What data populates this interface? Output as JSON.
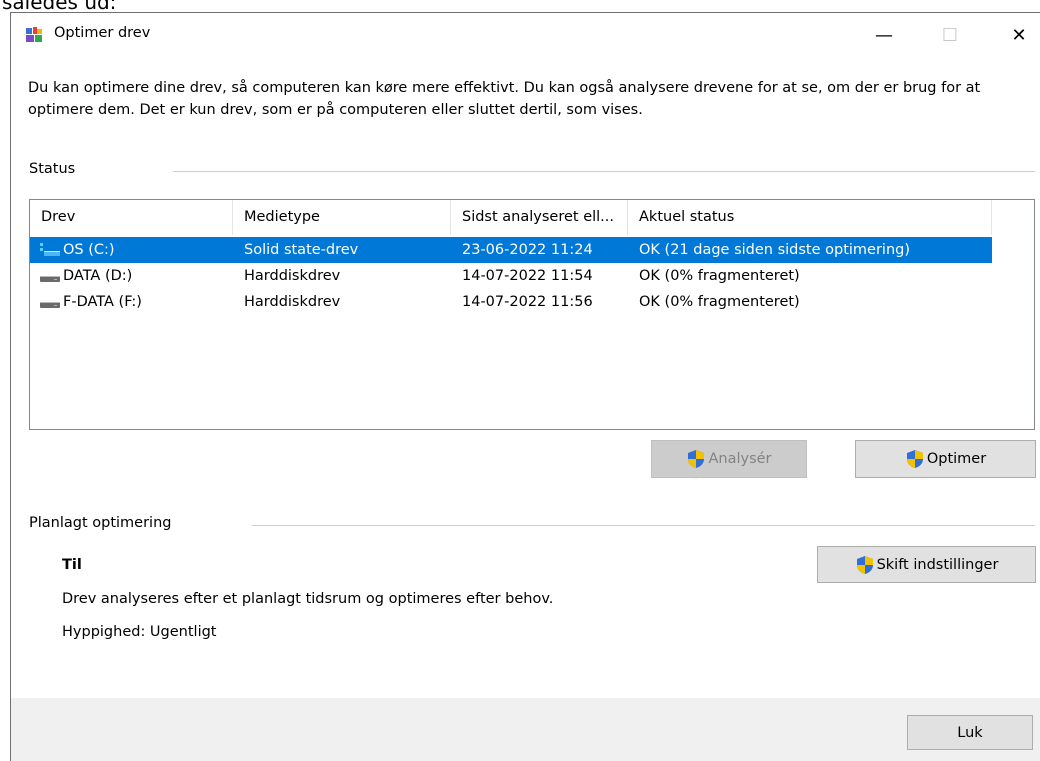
{
  "top_crop_text": "således ud:",
  "window": {
    "title": "Optimer drev",
    "minimize_glyph": "—",
    "maximize_glyph": "☐",
    "close_glyph": "✕"
  },
  "intro_text": "Du kan optimere dine drev, så computeren kan køre mere effektivt. Du kan også analysere drevene for at se, om der er brug for at optimere dem. Det er kun drev, som er på computeren eller sluttet dertil, som vises.",
  "status": {
    "label": "Status",
    "columns": [
      "Drev",
      "Medietype",
      "Sidst analyseret ell...",
      "Aktuel status"
    ],
    "rows": [
      {
        "drive": "OS (C:)",
        "media": "Solid state-drev",
        "last": "23-06-2022 11:24",
        "status": "OK (21 dage siden sidste optimering)",
        "selected": true,
        "icon": "ssd-drive-icon"
      },
      {
        "drive": "DATA (D:)",
        "media": "Harddiskdrev",
        "last": "14-07-2022 11:54",
        "status": "OK (0% fragmenteret)",
        "selected": false,
        "icon": "hdd-drive-icon"
      },
      {
        "drive": "F-DATA (F:)",
        "media": "Harddiskdrev",
        "last": "14-07-2022 11:56",
        "status": "OK (0% fragmenteret)",
        "selected": false,
        "icon": "hdd-drive-icon"
      }
    ]
  },
  "buttons": {
    "analyze": "Analysér",
    "optimize": "Optimer",
    "change_settings": "Skift indstillinger",
    "close": "Luk"
  },
  "schedule": {
    "label": "Planlagt optimering",
    "state": "Til",
    "description": "Drev analyseres efter et planlagt tidsrum og optimeres efter behov.",
    "frequency": "Hyppighed: Ugentligt"
  },
  "colors": {
    "selection": "#0078d7",
    "button_face": "#e1e1e1",
    "footer": "#f0f0f0"
  }
}
